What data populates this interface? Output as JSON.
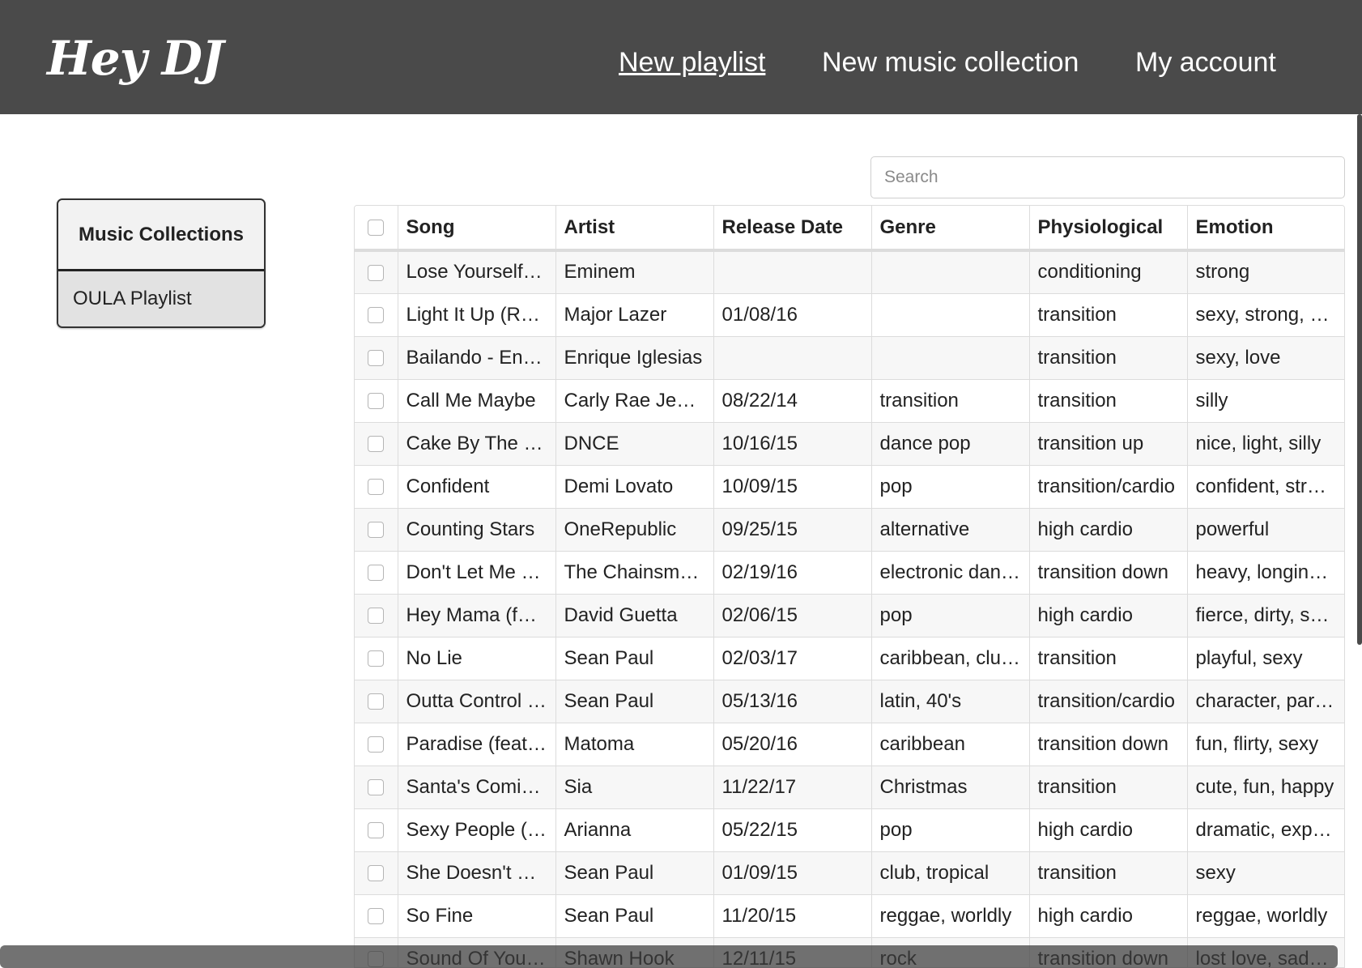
{
  "app": {
    "logo": "Hey DJ"
  },
  "nav": [
    {
      "label": "New playlist",
      "active": true
    },
    {
      "label": "New music collection",
      "active": false
    },
    {
      "label": "My account",
      "active": false
    }
  ],
  "sidebar": {
    "title": "Music Collections",
    "items": [
      {
        "label": "OULA Playlist"
      }
    ]
  },
  "search": {
    "placeholder": "Search",
    "value": ""
  },
  "table": {
    "columns": [
      "Song",
      "Artist",
      "Release Date",
      "Genre",
      "Physiological",
      "Emotion"
    ],
    "rows": [
      [
        "Lose Yourself …",
        "Eminem",
        "",
        "",
        "conditioning",
        "strong"
      ],
      [
        "Light It Up (R…",
        "Major Lazer",
        "01/08/16",
        "",
        "transition",
        "sexy, strong, …"
      ],
      [
        "Bailando - En…",
        "Enrique Iglesias",
        "",
        "",
        "transition",
        "sexy, love"
      ],
      [
        "Call Me Maybe",
        "Carly Rae Jep…",
        "08/22/14",
        "transition",
        "transition",
        "silly"
      ],
      [
        "Cake By The …",
        "DNCE",
        "10/16/15",
        "dance pop",
        "transition up",
        "nice, light, silly"
      ],
      [
        "Confident",
        "Demi Lovato",
        "10/09/15",
        "pop",
        "transition/cardio",
        "confident, strong"
      ],
      [
        "Counting Stars",
        "OneRepublic",
        "09/25/15",
        "alternative",
        "high cardio",
        "powerful"
      ],
      [
        "Don't Let Me …",
        "The Chainsm…",
        "02/19/16",
        "electronic dan…",
        "transition down",
        "heavy, longing…"
      ],
      [
        "Hey Mama (fe…",
        "David Guetta",
        "02/06/15",
        "pop",
        "high cardio",
        "fierce, dirty, sexy"
      ],
      [
        "No Lie",
        "Sean Paul",
        "02/03/17",
        "caribbean, clu…",
        "transition",
        "playful, sexy"
      ],
      [
        "Outta Control …",
        "Sean Paul",
        "05/13/16",
        "latin, 40's",
        "transition/cardio",
        "character, part…"
      ],
      [
        "Paradise (feat…",
        "Matoma",
        "05/20/16",
        "caribbean",
        "transition down",
        "fun, flirty, sexy"
      ],
      [
        "Santa's Comi…",
        "Sia",
        "11/22/17",
        "Christmas",
        "transition",
        "cute, fun, happy"
      ],
      [
        "Sexy People (…",
        "Arianna",
        "05/22/15",
        "pop",
        "high cardio",
        "dramatic, expr…"
      ],
      [
        "She Doesn't …",
        "Sean Paul",
        "01/09/15",
        "club, tropical",
        "transition",
        "sexy"
      ],
      [
        "So Fine",
        "Sean Paul",
        "11/20/15",
        "reggae, worldly",
        "high cardio",
        "reggae, worldly"
      ],
      [
        "Sound Of You…",
        "Shawn Hook",
        "12/11/15",
        "rock",
        "transition down",
        "lost love, sadn…"
      ]
    ]
  },
  "icons": {
    "checkbox": "checkbox-unchecked-icon"
  },
  "colors": {
    "header_bg": "#4a4a4a",
    "header_text": "#ffffff",
    "row_alt": "#f7f7f7",
    "border": "#dcdcdc"
  }
}
